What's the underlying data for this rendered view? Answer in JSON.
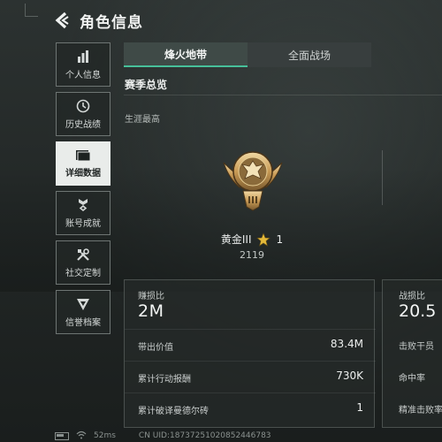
{
  "header": {
    "title": "角色信息"
  },
  "sidebar": {
    "items": [
      {
        "label": "个人信息",
        "icon": "bar-chart-icon"
      },
      {
        "label": "历史战绩",
        "icon": "history-icon"
      },
      {
        "label": "详细数据",
        "icon": "folder-icon",
        "active": true
      },
      {
        "label": "账号成就",
        "icon": "achievement-badge-icon"
      },
      {
        "label": "社交定制",
        "icon": "tools-icon"
      },
      {
        "label": "信誉档案",
        "icon": "credit-shield-icon"
      }
    ]
  },
  "tabs": [
    {
      "label": "烽火地带",
      "active": true
    },
    {
      "label": "全面战场",
      "active": false
    }
  ],
  "overview": {
    "title": "赛季总览",
    "career_label": "生涯最高",
    "rank_name": "黄金III",
    "rank_stars": "1",
    "rank_score": "2119"
  },
  "stats_left": {
    "head_label": "赚损比",
    "head_value": "2M",
    "rows": [
      {
        "label": "带出价值",
        "value": "83.4M"
      },
      {
        "label": "累计行动报酬",
        "value": "730K"
      },
      {
        "label": "累计破译曼德尔砖",
        "value": "1"
      }
    ]
  },
  "stats_right": {
    "head_label": "战损比",
    "head_value": "20.5",
    "rows": [
      {
        "label": "击败干员"
      },
      {
        "label": "命中率"
      },
      {
        "label": "精准击败率"
      }
    ]
  },
  "footer": {
    "ping": "52ms",
    "uid": "CN UID:18737251020852446783"
  },
  "colors": {
    "accent": "#47c09a",
    "active_sidebar_bg": "#e9ecea",
    "gold_star": "#e3b93a"
  }
}
